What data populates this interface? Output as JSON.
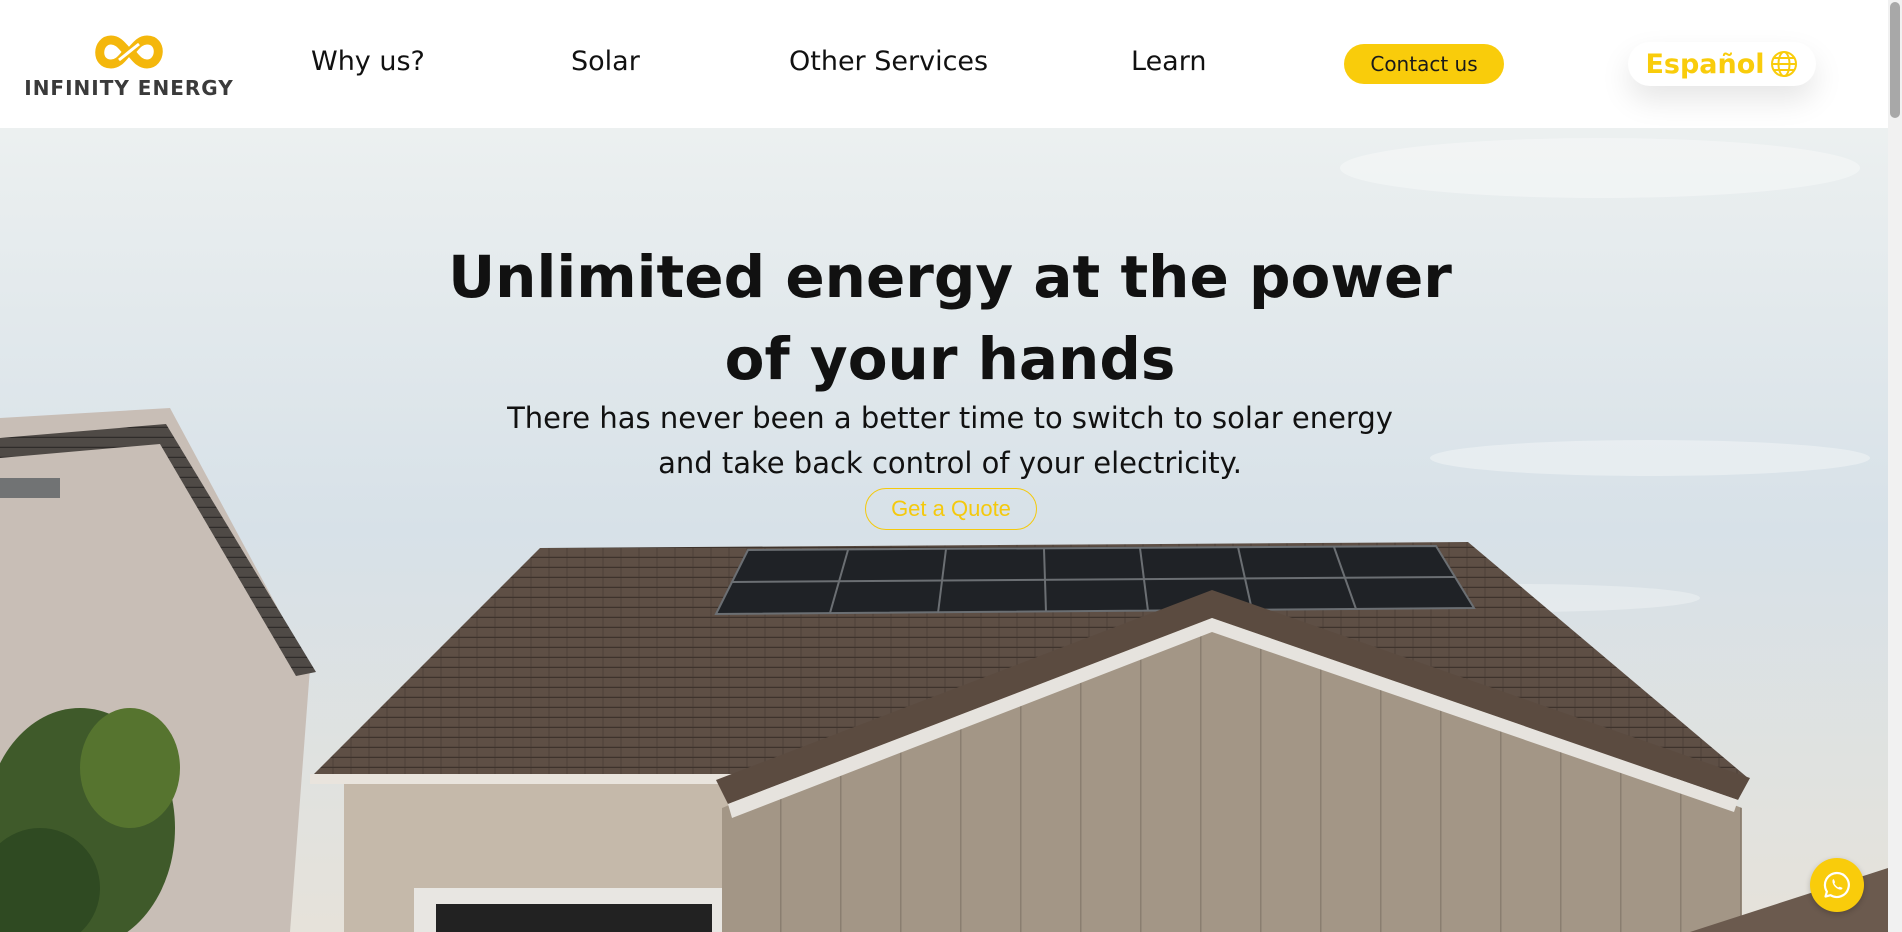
{
  "brand": {
    "name": "INFINITY ENERGY",
    "logo_icon": "infinity-icon",
    "accent_color": "#f9cc0b"
  },
  "nav": {
    "items": [
      {
        "label": "Why us?"
      },
      {
        "label": "Solar"
      },
      {
        "label": "Other Services"
      },
      {
        "label": "Learn"
      }
    ],
    "contact_label": "Contact us",
    "language_label": "Español",
    "language_icon": "globe-icon"
  },
  "hero": {
    "title": "Unlimited energy at the power of your hands",
    "subtitle": "There has never been a better time to switch to solar energy and take back control of your electricity.",
    "cta_label": "Get a Quote"
  },
  "floating": {
    "whatsapp_icon": "whatsapp-icon"
  }
}
